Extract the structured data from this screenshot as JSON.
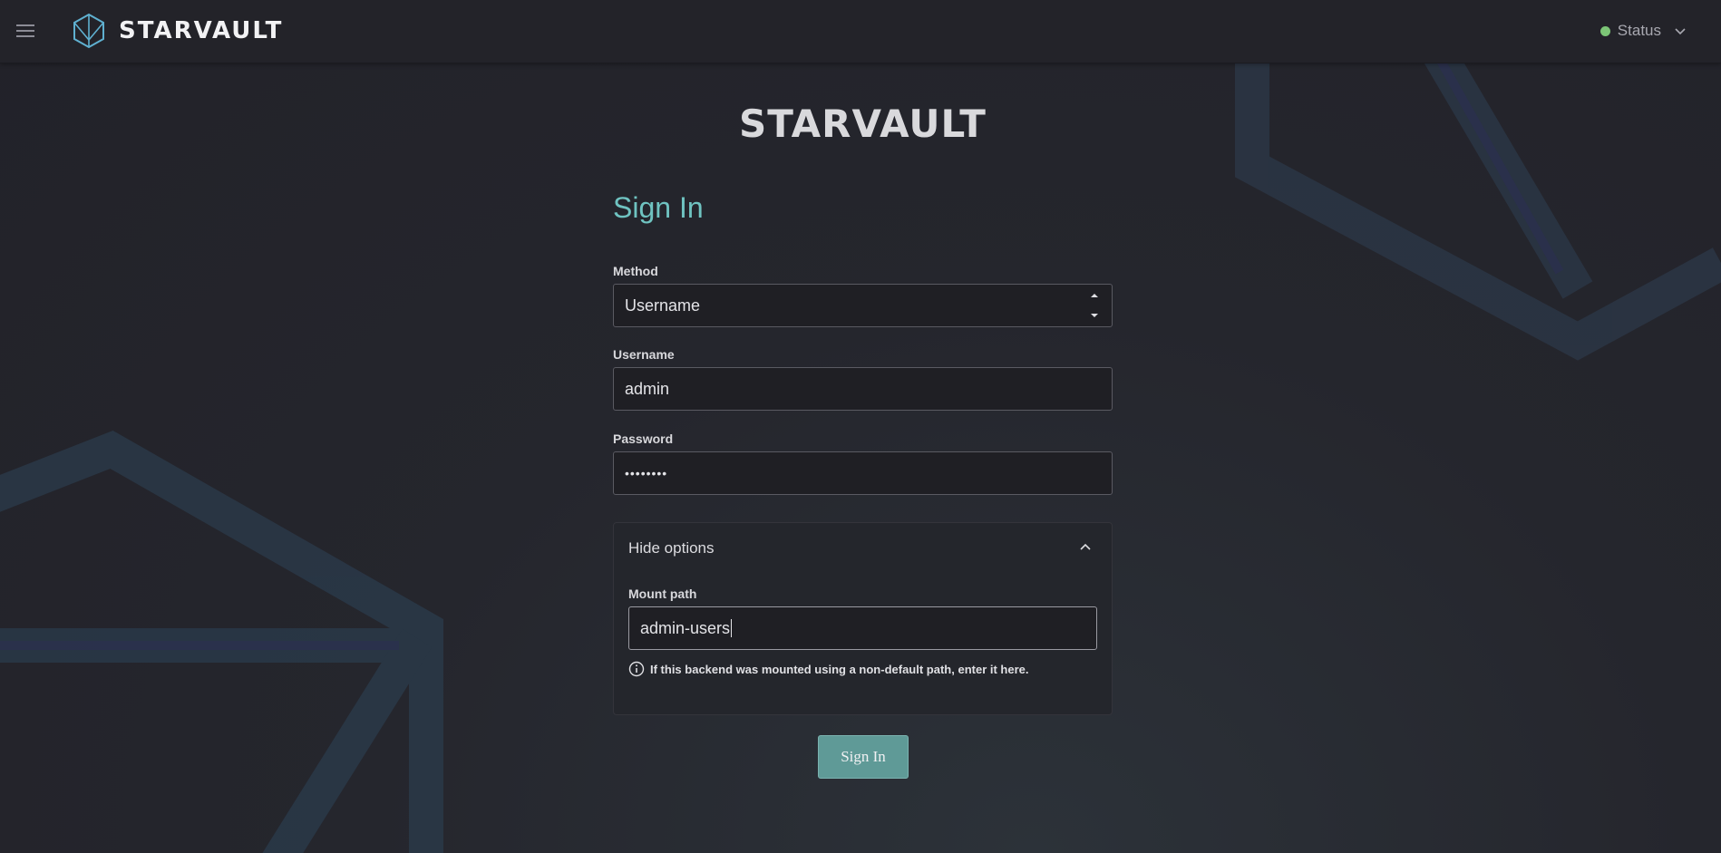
{
  "header": {
    "brand": "STARVAULT",
    "status_label": "Status",
    "status_color": "#7cc576"
  },
  "main": {
    "brand_title": "STARVAULT",
    "heading": "Sign In",
    "method": {
      "label": "Method",
      "value": "Username"
    },
    "username": {
      "label": "Username",
      "value": "admin"
    },
    "password": {
      "label": "Password",
      "masked_value": "••••••••"
    },
    "options": {
      "toggle_label": "Hide options",
      "mount_path": {
        "label": "Mount path",
        "value": "admin-users"
      },
      "help_text": "If this backend was mounted using a non-default path, enter it here."
    },
    "submit_label": "Sign In"
  },
  "colors": {
    "accent": "#6fc3c1",
    "button": "#5f9a97",
    "background": "#232329"
  },
  "icons": [
    "menu-icon",
    "vault-logo-icon",
    "chevron-down-icon",
    "chevron-up-icon",
    "select-arrows-icon",
    "info-icon"
  ]
}
